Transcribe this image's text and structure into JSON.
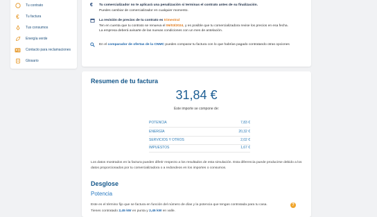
{
  "sidebar": {
    "items": [
      {
        "label": "Tu contrato",
        "icon": "contract-icon"
      },
      {
        "label": "Tu factura",
        "icon": "euro-icon"
      },
      {
        "label": "Tus consumos",
        "icon": "consumption-icon"
      },
      {
        "label": "Energía verde",
        "icon": "leaf-icon"
      },
      {
        "label": "Contacto para reclamaciones",
        "icon": "contact-card-icon"
      },
      {
        "label": "Glosario",
        "icon": "glossary-icon"
      }
    ]
  },
  "info": {
    "penalty_title": "Tu comercializador no te aplicará una penalización si terminas el contrato antes de su finalización.",
    "penalty_text": "Puedes cambiar de comercializador en cualquier momento.",
    "review_title_prefix": "La revisión de precios de tu contrato es",
    "review_period": "trimestral",
    "review_text_prefix": "Ten en cuenta que tu contrato se renueva el",
    "review_date": "06/03/2024",
    "review_text_suffix": ", y es posible que tu comercializadora revise los precios en esa fecha.",
    "review_notice": "La empresa deberá avisarte de las nuevas condiciones con un mes de antelación.",
    "compare_prefix": "En el",
    "compare_link": "comparador de ofertas de la CNMC",
    "compare_suffix": "puedes comparar tu factura con lo que habrías pagado contratando otras opciones"
  },
  "summary": {
    "title": "Resumen de tu factura",
    "total": "31,84 €",
    "subtitle": "Este importe se compone de:",
    "rows": [
      {
        "label": "POTENCIA",
        "value": "7,83 €"
      },
      {
        "label": "ENERGÍA",
        "value": "20,32 €"
      },
      {
        "label": "SERVICIOS Y OTROS",
        "value": "2,02 €"
      },
      {
        "label": "IMPUESTOS",
        "value": "1,67 €"
      }
    ],
    "disclaimer": "Los datos mostrados en la factura pueden diferir respecto a los resultados de esta simulación. Esta diferencia puede producirse debido a los datos proporcionados por tu comercializadora o a redondeos en los importes o consumos."
  },
  "desglose": {
    "title": "Desglose",
    "potencia_title": "Potencia",
    "potencia_text": "Este es el término fijo que se factura en función del número de días y la potencia que tengas contratada para tu casa.",
    "contracted_prefix": "Tienes contratado",
    "contracted_punta": "2,45 kW",
    "contracted_mid": "en punta y",
    "contracted_valle": "2,45 kW",
    "contracted_suffix": "en valle."
  }
}
